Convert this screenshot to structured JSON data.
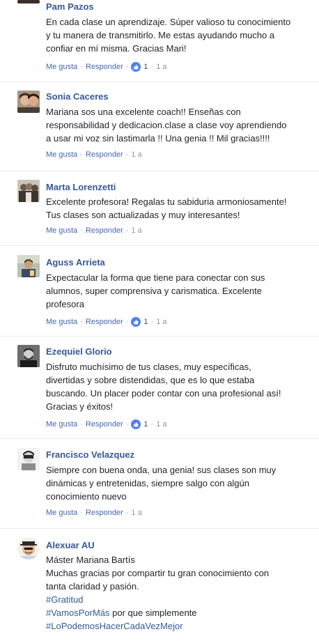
{
  "comments": [
    {
      "name": "Pam Pazos",
      "lines": [
        "En cada clase un aprendizaje. Súper valioso tu conocimiento",
        "y tu manera de transmitirlo. Me estas ayudando mucho a",
        "confiar en mí misma. Gracias Mari!"
      ],
      "like": "Me gusta",
      "reply": "Responder",
      "reactions": "1",
      "time": "1 a"
    },
    {
      "name": "Sonia Caceres",
      "lines": [
        "Mariana sos una excelente coach!! Enseñas con",
        "responsabilidad y dedicacion.clase a clase voy aprendiendo",
        "a usar mi voz sin lastimarla !! Una genia !! Mil gracias!!!!"
      ],
      "like": "Me gusta",
      "reply": "Responder",
      "time": "1 a"
    },
    {
      "name": "Marta Lorenzetti",
      "lines": [
        "Excelente profesora! Regalas tu sabiduria armoniosamente!",
        "Tus clases son actualizadas y muy interesantes!"
      ],
      "like": "Me gusta",
      "reply": "Responder",
      "time": "1 a"
    },
    {
      "name": "Aguss Arrieta",
      "lines": [
        "Expectacular la forma que tiene para conectar con sus",
        "alumnos, super comprensiva y carismatica. Excelente",
        "profesora"
      ],
      "like": "Me gusta",
      "reply": "Responder",
      "reactions": "1",
      "time": "1 a"
    },
    {
      "name": "Ezequiel Glorio",
      "lines": [
        "Disfruto muchísimo de tus clases, muy específicas,",
        "divertidas y sobre distendidas, que es lo que estaba",
        "buscando. Un placer poder contar con una profesional así!",
        "Gracias y éxitos!"
      ],
      "like": "Me gusta",
      "reply": "Responder",
      "reactions": "1",
      "time": "1 a"
    },
    {
      "name": "Francisco Velazquez",
      "lines": [
        "Siempre con buena onda, una genia! sus clases son muy",
        "dinámicas y entretenidas, siempre salgo con algún",
        "conocimiento nuevo"
      ],
      "like": "Me gusta",
      "reply": "Responder",
      "time": "1 a"
    },
    {
      "name": "Alexuar AU",
      "lines": [
        "Máster Mariana Bartís",
        "Muchas gracias por compartir tu gran conocimiento con",
        "tanta claridad y pasión."
      ],
      "hashtags": [
        "#Gratitud",
        "#VamosPorMás",
        "#LoPodemosHacerCadaVezMejor"
      ],
      "hashtag_suffix": " por que simplemente"
    }
  ],
  "colors": {
    "link": "#365899",
    "action": "#4267b2",
    "meta": "#90949c",
    "text": "#1d2129",
    "like": "#4f7ff5"
  }
}
